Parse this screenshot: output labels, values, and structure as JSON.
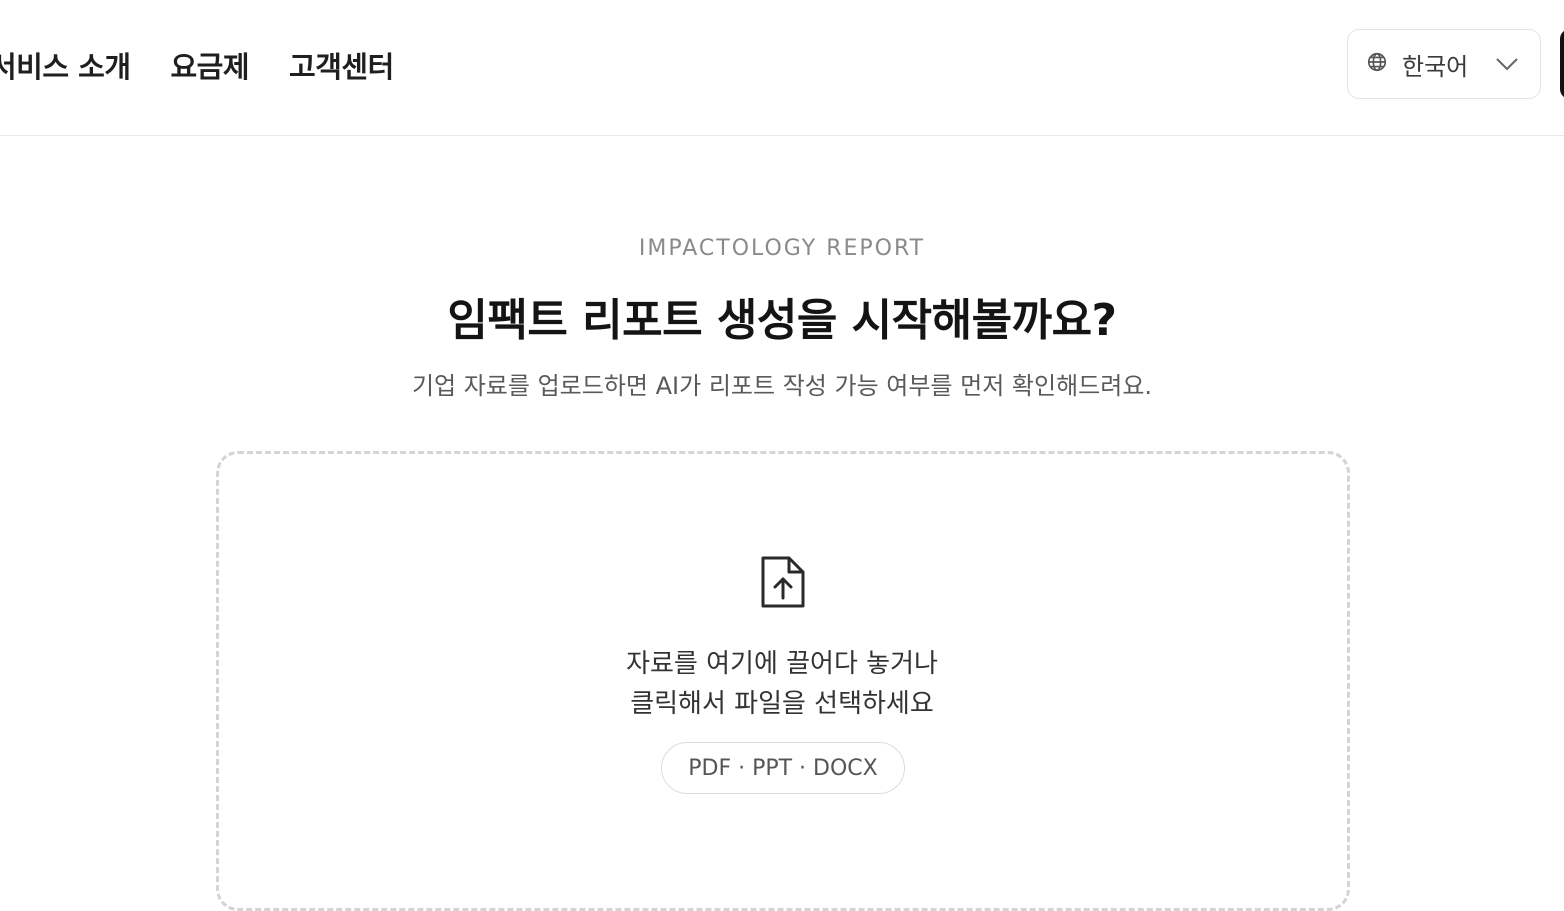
{
  "nav": {
    "items": [
      {
        "label": "서비스 소개"
      },
      {
        "label": "요금제"
      },
      {
        "label": "고객센터"
      }
    ]
  },
  "language": {
    "icon": "globe-icon",
    "selected": "한국어",
    "dropdown_icon": "chevron-down-icon"
  },
  "hero": {
    "eyebrow": "IMPACTOLOGY REPORT",
    "title": "임팩트 리포트 생성을 시작해볼까요?",
    "subtitle": "기업 자료를 업로드하면 AI가 리포트 작성 가능 여부를 먼저 확인해드려요."
  },
  "upload": {
    "icon": "file-upload-icon",
    "line1": "자료를 여기에 끌어다 놓거나",
    "line2": "클릭해서 파일을 선택하세요",
    "formats": "PDF · PPT · DOCX"
  },
  "colors": {
    "text_primary": "#141414",
    "text_muted": "#8a8a8a",
    "border": "#d4d4d4"
  }
}
